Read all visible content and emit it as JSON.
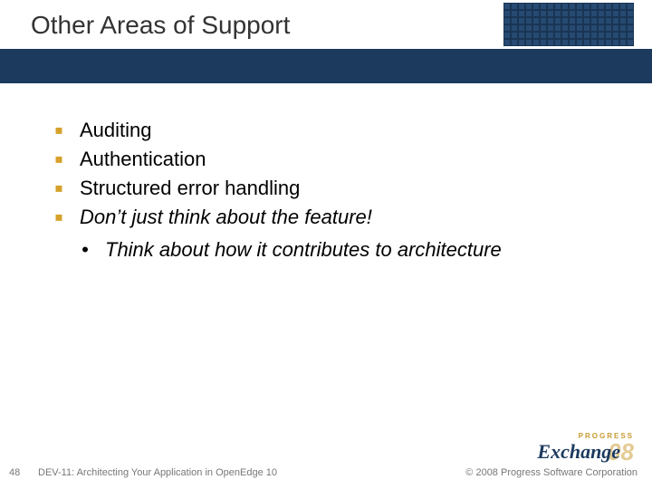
{
  "title": "Other Areas of Support",
  "bullets": [
    "Auditing",
    "Authentication",
    "Structured error handling",
    "Don’t just think about the feature!"
  ],
  "sub_bullet": "Think about how it contributes to architecture",
  "footer": {
    "slide_number": "48",
    "session": "DEV-11: Architecting Your Application in OpenEdge 10",
    "copyright": "© 2008 Progress Software Corporation"
  },
  "logo": {
    "top": "PROGRESS",
    "main": "Exchange",
    "year": "08"
  }
}
